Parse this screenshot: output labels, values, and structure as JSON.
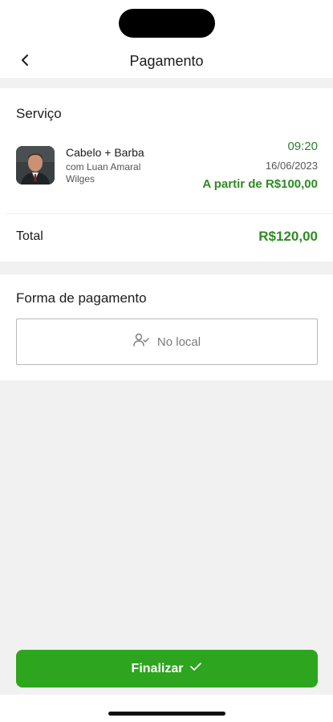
{
  "header": {
    "title": "Pagamento",
    "back_icon": "chevron-left-icon"
  },
  "service_section": {
    "title": "Serviço",
    "service": {
      "name": "Cabelo + Barba",
      "professional": "com Luan Amaral Wilges",
      "time": "09:20",
      "date": "16/06/2023",
      "price": "A partir de R$100,00"
    },
    "total_label": "Total",
    "total_value": "R$120,00"
  },
  "payment_section": {
    "title": "Forma de pagamento",
    "option": {
      "label": "No local",
      "icon": "user-check-icon"
    }
  },
  "actions": {
    "finalize_label": "Finalizar",
    "finalize_icon": "checkmark-icon"
  },
  "colors": {
    "accent_green": "#2da51e",
    "price_green": "#2e8b23",
    "background": "#f1f1f1"
  }
}
